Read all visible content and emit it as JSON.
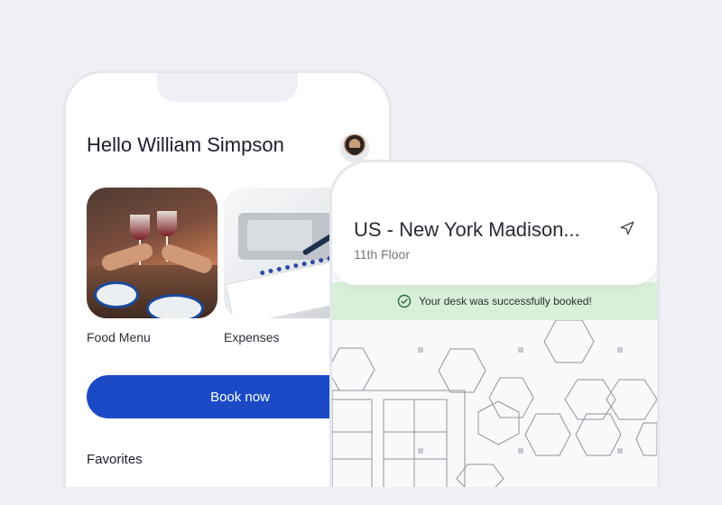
{
  "home": {
    "greeting": "Hello William Simpson",
    "cards": [
      {
        "label": "Food Menu"
      },
      {
        "label": "Expenses"
      }
    ],
    "book_button": "Book now",
    "favorites_heading": "Favorites"
  },
  "booking": {
    "location_title": "US - New York Madison...",
    "floor": "11th Floor",
    "success_message": "Your desk was successfully booked!"
  },
  "colors": {
    "background": "#eef0f5",
    "primary": "#1c49c6",
    "success_bg": "#d8efda",
    "success_icon": "#2f6b3d"
  },
  "icons": [
    "avatar",
    "navigation-arrow-icon",
    "check-circle-icon"
  ]
}
